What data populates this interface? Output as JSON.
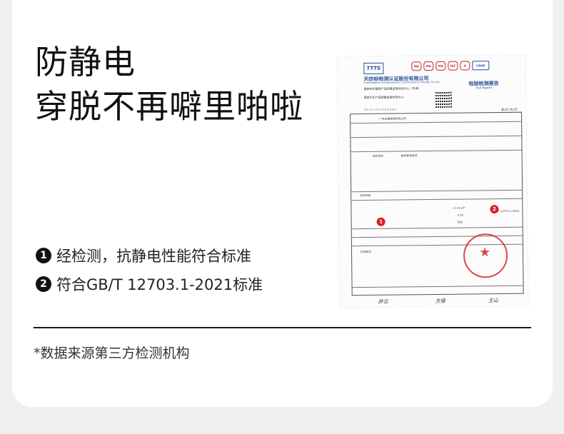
{
  "headline": {
    "line1": "防静电",
    "line2": "穿脱不再噼里啪啦"
  },
  "bullets": [
    {
      "num": "1",
      "text": "经检测，抗静电性能符合标准"
    },
    {
      "num": "2",
      "text": "符合GB/T 12703.1-2021标准"
    }
  ],
  "footnote": "*数据来源第三方检测机构",
  "report": {
    "logo": "TTTS",
    "marks": [
      "MA",
      "MA",
      "MA",
      "TAC",
      "A",
      "CNAS"
    ],
    "company_cn": "天纺标检测认证股份有限公司",
    "company_en": "TianFangBiao Standardization Certification & Testing Co.,Ltd.",
    "line_a": "国家纺织服装产品质量监督检验中心（天津）",
    "line_b": "国家针织产品质量监督检验中心",
    "title": "检验检测报告",
    "title_en": "Test Report",
    "serial": "S S 2 5 - 0 7 2 2 0 0 0 0 8",
    "page": "第1页 共1页",
    "badges": [
      "1",
      "2"
    ],
    "table": {
      "client": "广东品格服装有限公司",
      "std_left": "GB/T 12703.1-2021",
      "product_label": "样品名称",
      "product": "圆领套装男袜",
      "section": "检测项目",
      "conclusion": "检测结论",
      "results": [
        "—2.4×10⁸",
        "0.56",
        "符合"
      ]
    }
  }
}
